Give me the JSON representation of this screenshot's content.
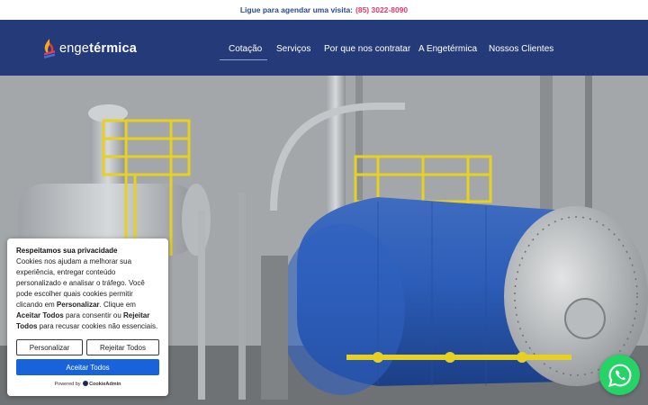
{
  "topbar": {
    "text": "Ligue para agendar uma visita:",
    "phone": "(85) 3022-8090"
  },
  "header": {
    "logo": {
      "part1": "enge",
      "part2": "térmica"
    },
    "nav": [
      {
        "label": "Cotação"
      },
      {
        "label": "Serviços"
      },
      {
        "label": "Por que nos contratar"
      },
      {
        "label": "A Engetérmica"
      },
      {
        "label": "Nossos Clientes"
      }
    ]
  },
  "hero": {
    "image_icon": "industrial-boiler-photo"
  },
  "cookie": {
    "title": "Respeitamos sua privacidade",
    "body_1": "Cookies nos ajudam a melhorar sua experiência, entregar conteúdo personalizado e analisar o tráfego. Você pode escolher quais cookies permitir clicando em ",
    "body_customize": "Personalizar",
    "body_2": ". Clique em ",
    "body_accept": "Aceitar Todos",
    "body_3": " para consentir ou ",
    "body_reject": "Rejeitar Todos",
    "body_4": " para recusar cookies não essenciais.",
    "customize_label": "Personalizar",
    "reject_label": "Rejeitar Todos",
    "accept_label": "Aceitar Todos",
    "powered_by": "Powered by",
    "powered_brand": "CookieAdmin"
  },
  "whatsapp": {
    "icon": "whatsapp-icon"
  },
  "colors": {
    "header_bg": "#253a78",
    "phone": "#e03a6a",
    "accept": "#1863dc",
    "whatsapp": "#25d366"
  }
}
